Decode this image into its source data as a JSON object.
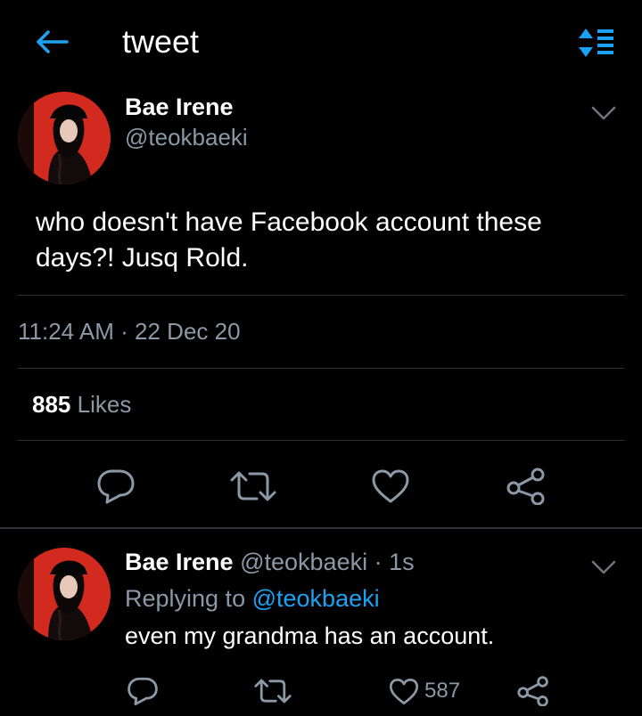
{
  "header": {
    "title": "tweet",
    "back_icon": "arrow-left-icon",
    "sort_icon": "sort-list-icon",
    "accent_color": "#1da1f2"
  },
  "tweet": {
    "author_name": "Bae Irene",
    "author_handle": "@teokbaeki",
    "text": "who doesn't have Facebook account these days?! Jusq Rold.",
    "timestamp": "11:24 AM · 22 Dec 20",
    "likes_count": "885",
    "likes_label": "Likes",
    "actions": [
      "reply-icon",
      "retweet-icon",
      "like-icon",
      "share-icon"
    ]
  },
  "reply": {
    "author_name": "Bae Irene",
    "author_handle": "@teokbaeki",
    "time": "· 1s",
    "replying_prefix": "Replying to",
    "replying_to": "@teokbaeki",
    "text": "even my grandma has an account.",
    "like_count": "587",
    "actions": [
      "reply-icon",
      "retweet-icon",
      "like-icon",
      "share-icon"
    ]
  },
  "colors": {
    "background": "#000000",
    "text": "#ffffff",
    "secondary_text": "#8b98a5",
    "divider": "#2f3336",
    "link": "#1da1f2",
    "avatar_background": "#d32a20"
  }
}
